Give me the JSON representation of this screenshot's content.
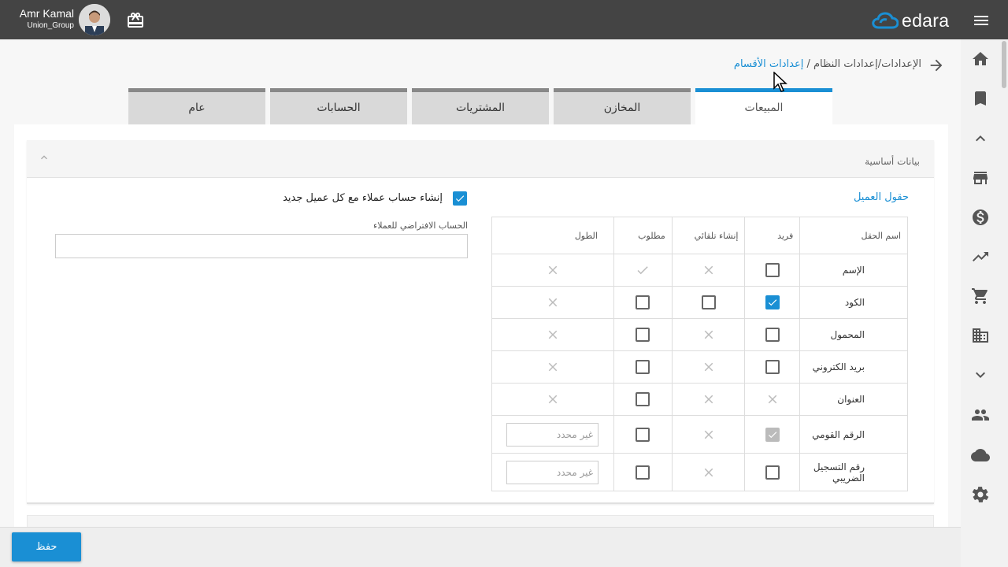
{
  "header": {
    "user_name": "Amr Kamal",
    "company": "Union_Group",
    "brand": "edara",
    "icons": [
      "avatar",
      "gift-icon",
      "edara-logo-icon",
      "menu-icon"
    ]
  },
  "breadcrumb": {
    "path": "الإعدادات/إعدادات النظام / ",
    "active": "إعدادات الأقسام"
  },
  "tabs": [
    {
      "label": "المبيعات",
      "active": true
    },
    {
      "label": "المخازن",
      "active": false
    },
    {
      "label": "المشتريات",
      "active": false
    },
    {
      "label": "الحسابات",
      "active": false
    },
    {
      "label": "عام",
      "active": false
    }
  ],
  "section": {
    "title": "بيانات أساسية",
    "fields_title": "حقول العميل",
    "columns": [
      "اسم الحقل",
      "فريد",
      "إنشاء تلقائي",
      "مطلوب",
      "الطول"
    ],
    "rows": [
      {
        "name": "الإسم",
        "unique": "unchecked",
        "auto": "x",
        "required": "check",
        "length": "x"
      },
      {
        "name": "الكود",
        "unique": "checked",
        "auto": "unchecked",
        "required": "unchecked",
        "length": "x"
      },
      {
        "name": "المحمول",
        "unique": "unchecked",
        "auto": "x",
        "required": "unchecked",
        "length": "x"
      },
      {
        "name": "بريد الكتروني",
        "unique": "unchecked",
        "auto": "x",
        "required": "unchecked",
        "length": "x"
      },
      {
        "name": "العنوان",
        "unique": "x",
        "auto": "x",
        "required": "unchecked",
        "length": "x"
      },
      {
        "name": "الرقم القومي",
        "unique": "disabled-checked",
        "auto": "x",
        "required": "unchecked",
        "length": "غير محدد"
      },
      {
        "name": "رقم التسجيل الضريبي",
        "unique": "unchecked",
        "auto": "x",
        "required": "unchecked",
        "length": "غير محدد"
      }
    ],
    "create_account_label": "إنشاء حساب عملاء مع كل عميل جديد",
    "create_account_checked": true,
    "default_account_label": "الحساب الافتراضي للعملاء",
    "default_account_value": ""
  },
  "footer": {
    "save_label": "حفظ"
  },
  "colors": {
    "accent": "#1a8fd4",
    "topbar": "#444444"
  },
  "sidebar_icons": [
    "home-icon",
    "bookmark-icon",
    "chevron-up-icon",
    "store-icon",
    "dollar-icon",
    "trending-up-icon",
    "cart-icon",
    "building-icon",
    "chevron-down-icon",
    "people-icon",
    "cloud-icon",
    "settings-icon"
  ]
}
